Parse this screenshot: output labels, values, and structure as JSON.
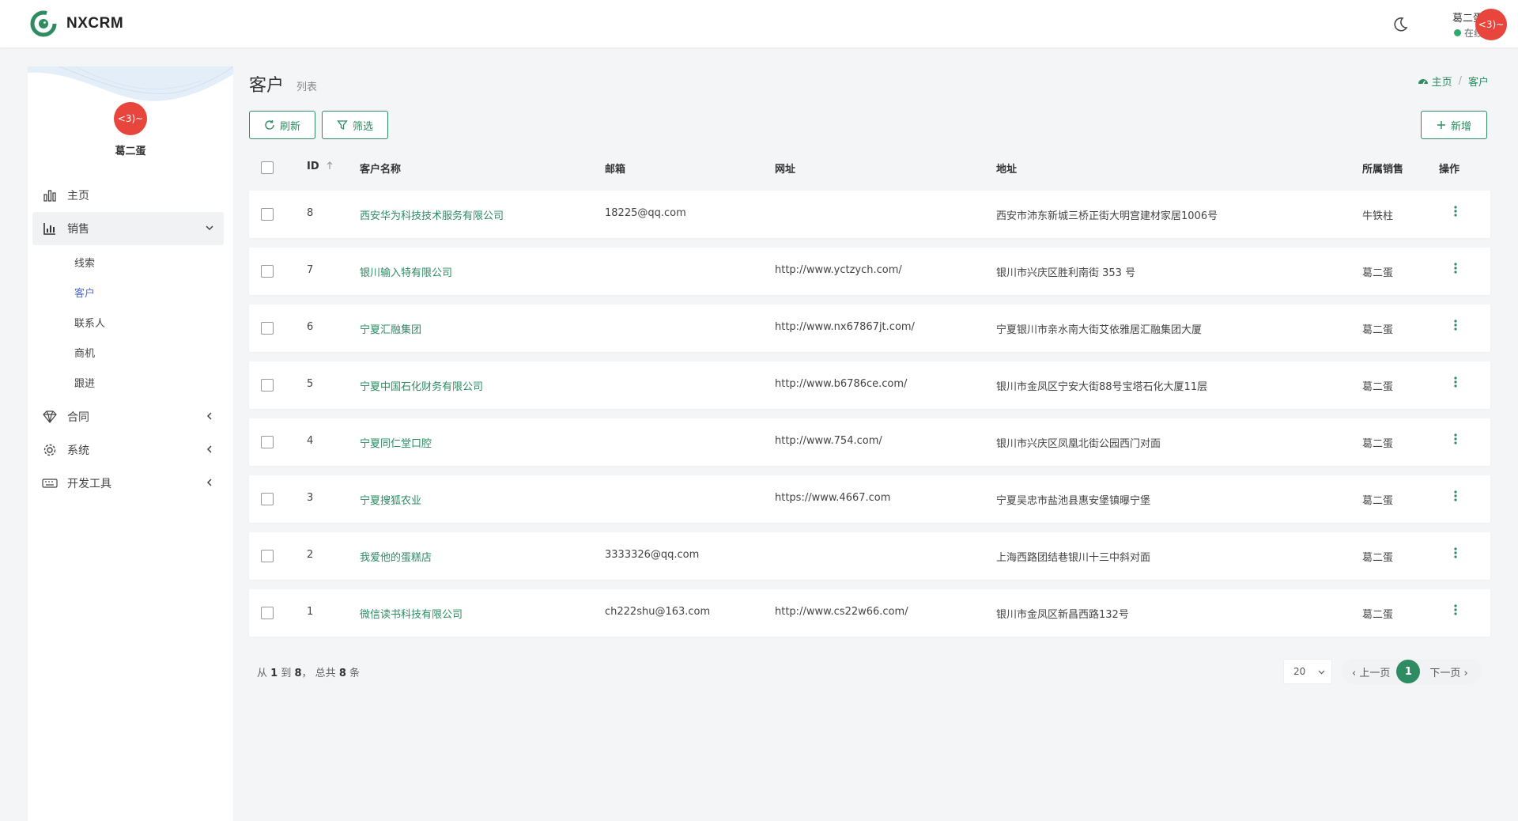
{
  "app": {
    "name": "NXCRM"
  },
  "user": {
    "name": "葛二蛋",
    "status": "在线",
    "avatar_text": "<3)~"
  },
  "colors": {
    "accent": "#2e8b62",
    "avatar": "#e8453c",
    "active_nav": "#4a6fdc"
  },
  "sidebar": {
    "username": "葛二蛋",
    "avatar_text": "<3)~",
    "items": [
      {
        "label": "主页",
        "icon": "bar-chart-icon"
      },
      {
        "label": "销售",
        "icon": "chart-icon",
        "expanded": true,
        "children": [
          {
            "label": "线索"
          },
          {
            "label": "客户",
            "active": true
          },
          {
            "label": "联系人"
          },
          {
            "label": "商机"
          },
          {
            "label": "跟进"
          }
        ]
      },
      {
        "label": "合同",
        "icon": "diamond-icon"
      },
      {
        "label": "系统",
        "icon": "gear-icon"
      },
      {
        "label": "开发工具",
        "icon": "keyboard-icon"
      }
    ]
  },
  "page": {
    "title": "客户",
    "subtitle": "列表"
  },
  "breadcrumb": {
    "home": "主页",
    "current": "客户"
  },
  "toolbar": {
    "refresh": "刷新",
    "filter": "筛选",
    "add": "新增"
  },
  "table": {
    "columns": {
      "id": "ID",
      "name": "客户名称",
      "email": "邮箱",
      "url": "网址",
      "address": "地址",
      "sales": "所属销售",
      "actions": "操作"
    },
    "rows": [
      {
        "id": "8",
        "name": "西安华为科技技术服务有限公司",
        "email": "18225@qq.com",
        "url": "",
        "address": "西安市沛东新城三桥正街大明宫建材家居1006号",
        "sales": "牛铁柱"
      },
      {
        "id": "7",
        "name": "银川输入特有限公司",
        "email": "",
        "url": "http://www.yctzych.com/",
        "address": "银川市兴庆区胜利南街 353 号",
        "sales": "葛二蛋"
      },
      {
        "id": "6",
        "name": "宁夏汇融集团",
        "email": "",
        "url": "http://www.nx67867jt.com/",
        "address": "宁夏银川市亲水南大街艾依雅居汇融集团大厦",
        "sales": "葛二蛋"
      },
      {
        "id": "5",
        "name": "宁夏中国石化财务有限公司",
        "email": "",
        "url": "http://www.b6786ce.com/",
        "address": "银川市金凤区宁安大街88号宝塔石化大厦11层",
        "sales": "葛二蛋"
      },
      {
        "id": "4",
        "name": "宁夏同仁堂口腔",
        "email": "",
        "url": "http://www.754.com/",
        "address": "银川市兴庆区凤凰北街公园西门对面",
        "sales": "葛二蛋"
      },
      {
        "id": "3",
        "name": "宁夏搜狐农业",
        "email": "",
        "url": "https://www.4667.com",
        "address": "宁夏吴忠市盐池县惠安堡镇曝宁堡",
        "sales": "葛二蛋"
      },
      {
        "id": "2",
        "name": "我爱他的蛋糕店",
        "email": "3333326@qq.com",
        "url": "",
        "address": "上海西路团结巷银川十三中斜对面",
        "sales": "葛二蛋"
      },
      {
        "id": "1",
        "name": "微信读书科技有限公司",
        "email": "ch222shu@163.com",
        "url": "http://www.cs22w66.com/",
        "address": "银川市金凤区新昌西路132号",
        "sales": "葛二蛋"
      }
    ]
  },
  "footer": {
    "summary_from": "从",
    "summary_start": "1",
    "summary_to": "到",
    "summary_end": "8",
    "summary_total_label": "，  总共",
    "summary_total": "8",
    "summary_unit": "条",
    "page_size": "20",
    "prev": "上一页",
    "current_page": "1",
    "next": "下一页"
  }
}
